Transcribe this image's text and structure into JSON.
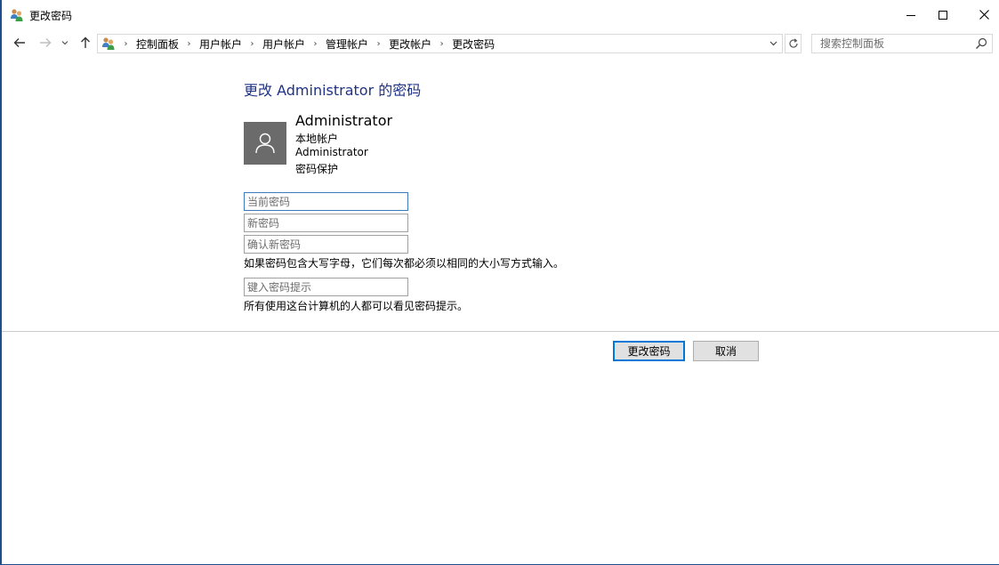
{
  "window": {
    "title": "更改密码",
    "icon": "users-icon"
  },
  "address_bar": {
    "breadcrumbs": [
      "控制面板",
      "用户帐户",
      "用户帐户",
      "管理帐户",
      "更改帐户",
      "更改密码"
    ]
  },
  "search": {
    "placeholder": "搜索控制面板"
  },
  "main": {
    "heading": "更改 Administrator 的密码",
    "account": {
      "name": "Administrator",
      "type": "本地帐户",
      "username": "Administrator",
      "protection": "密码保护"
    },
    "fields": {
      "current_password_placeholder": "当前密码",
      "new_password_placeholder": "新密码",
      "confirm_password_placeholder": "确认新密码",
      "hint_placeholder": "键入密码提示"
    },
    "case_note": "如果密码包含大写字母，它们每次都必须以相同的大小写方式输入。",
    "hint_note": "所有使用这台计算机的人都可以看见密码提示。"
  },
  "buttons": {
    "change_password": "更改密码",
    "cancel": "取消"
  },
  "colors": {
    "heading": "#1e3287",
    "accent": "#0078d7",
    "avatar_bg": "#6b6b6b"
  }
}
